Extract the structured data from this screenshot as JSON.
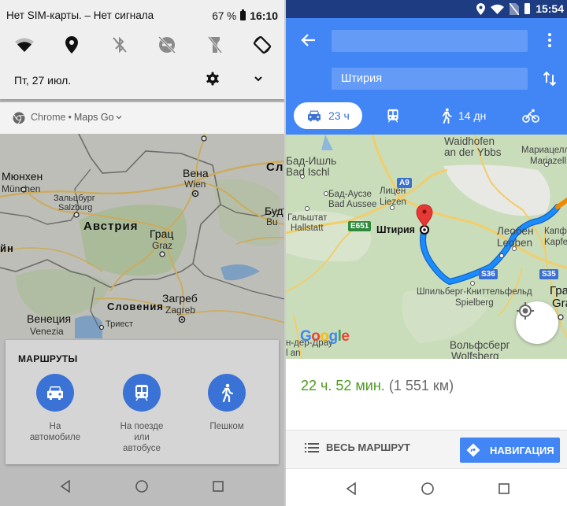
{
  "left": {
    "status": {
      "carrier": "Нет SIM-карты. – Нет сигнала",
      "battery": "67 %",
      "time": "16:10"
    },
    "quick_tiles": [
      {
        "name": "wifi",
        "icon": "wifi-icon",
        "state": "on"
      },
      {
        "name": "location",
        "icon": "location-pin-icon",
        "state": "on"
      },
      {
        "name": "bluetooth",
        "icon": "bluetooth-off-icon",
        "state": "off"
      },
      {
        "name": "do-not-disturb",
        "icon": "dnd-off-icon",
        "state": "off"
      },
      {
        "name": "flashlight",
        "icon": "flashlight-off-icon",
        "state": "off"
      },
      {
        "name": "auto-rotate",
        "icon": "auto-rotate-icon",
        "state": "on"
      }
    ],
    "date": "Пт, 27 июл.",
    "notification": {
      "app": "Chrome",
      "separator": "•",
      "subtext": "Maps Go"
    },
    "map_labels": {
      "munich_ru": "Мюнхен",
      "munich": "München",
      "salzburg_ru": "Зальцбург",
      "salzburg": "Salzburg",
      "austria": "Австрия",
      "vienna_ru": "Вена",
      "vienna": "Wien",
      "graz_ru": "Грац",
      "graz": "Graz",
      "slovenia": "Словения",
      "zagreb_ru": "Загреб",
      "zagreb": "Zagreb",
      "venice_ru": "Венеция",
      "venice": "Venezia",
      "trieste_ru": "Триест",
      "budapest_ru": "Буд",
      "budapest": "Bu",
      "slovakia_partial": "Сл",
      "liechtenstein_partial": "йн"
    },
    "routes_card": {
      "title": "МАРШРУТЫ",
      "options": [
        {
          "label_line1": "На",
          "label_line2": "автомобиле",
          "label_line3": "",
          "icon": "car-icon"
        },
        {
          "label_line1": "На поезде",
          "label_line2": "или",
          "label_line3": "автобусе",
          "icon": "train-icon"
        },
        {
          "label_line1": "Пешком",
          "label_line2": "",
          "label_line3": "",
          "icon": "walk-icon"
        }
      ]
    }
  },
  "right": {
    "status": {
      "time": "15:54"
    },
    "from_field": {
      "value": ""
    },
    "to_field": {
      "value": "Штирия"
    },
    "modes": [
      {
        "mode": "car",
        "label": "23 ч",
        "active": true
      },
      {
        "mode": "transit",
        "label": "",
        "active": false
      },
      {
        "mode": "walk",
        "label": "14 дн",
        "active": false
      },
      {
        "mode": "bike",
        "label": "",
        "active": false
      }
    ],
    "map_labels": {
      "waidhofen1": "Waidhofen",
      "waidhofen2": "an der Ybbs",
      "mariazell_ru": "Мариацелль",
      "mariazell": "Mariazell",
      "badischl_ru": "Бад-Ишль",
      "badischl": "Bad Ischl",
      "badaussee_ru": "Бад-Аусзе",
      "badaussee": "Bad Aussee",
      "liezen_ru": "Лицен",
      "liezen": "Liezen",
      "hallstatt_ru": "Гальштат",
      "hallstatt": "Hallstatt",
      "leoben_ru": "Леобен",
      "leoben": "Leoben",
      "kapfenberg_ru": "Капф",
      "kapfenberg": "Kapfe",
      "styria": "Штирия",
      "spielberg_ru": "Шпильберг-Книттельфельд",
      "spielberg": "Spielberg",
      "graz_ru": "Гра",
      "graz": "Gra",
      "wolfsberg_ru": "Вольфсберг",
      "wolfsberg": "Wolfsberg",
      "drau_ru": "н-дер-Драу",
      "drau": "l an",
      "google": "Google"
    },
    "road_shields": {
      "a9": "A9",
      "e651": "E651",
      "s36": "S36",
      "s35": "S35"
    },
    "summary": {
      "duration": "22 ч. 52 мин.",
      "distance": "(1 551 км)"
    },
    "actions": {
      "all_route": "ВЕСЬ МАРШРУТ",
      "navigate": "НАВИГАЦИЯ"
    },
    "colors": {
      "header_blue": "#4285f4",
      "status_blue": "#1d3c82",
      "duration_green": "#4d9b1f",
      "route_blue": "#1a8cff"
    }
  }
}
